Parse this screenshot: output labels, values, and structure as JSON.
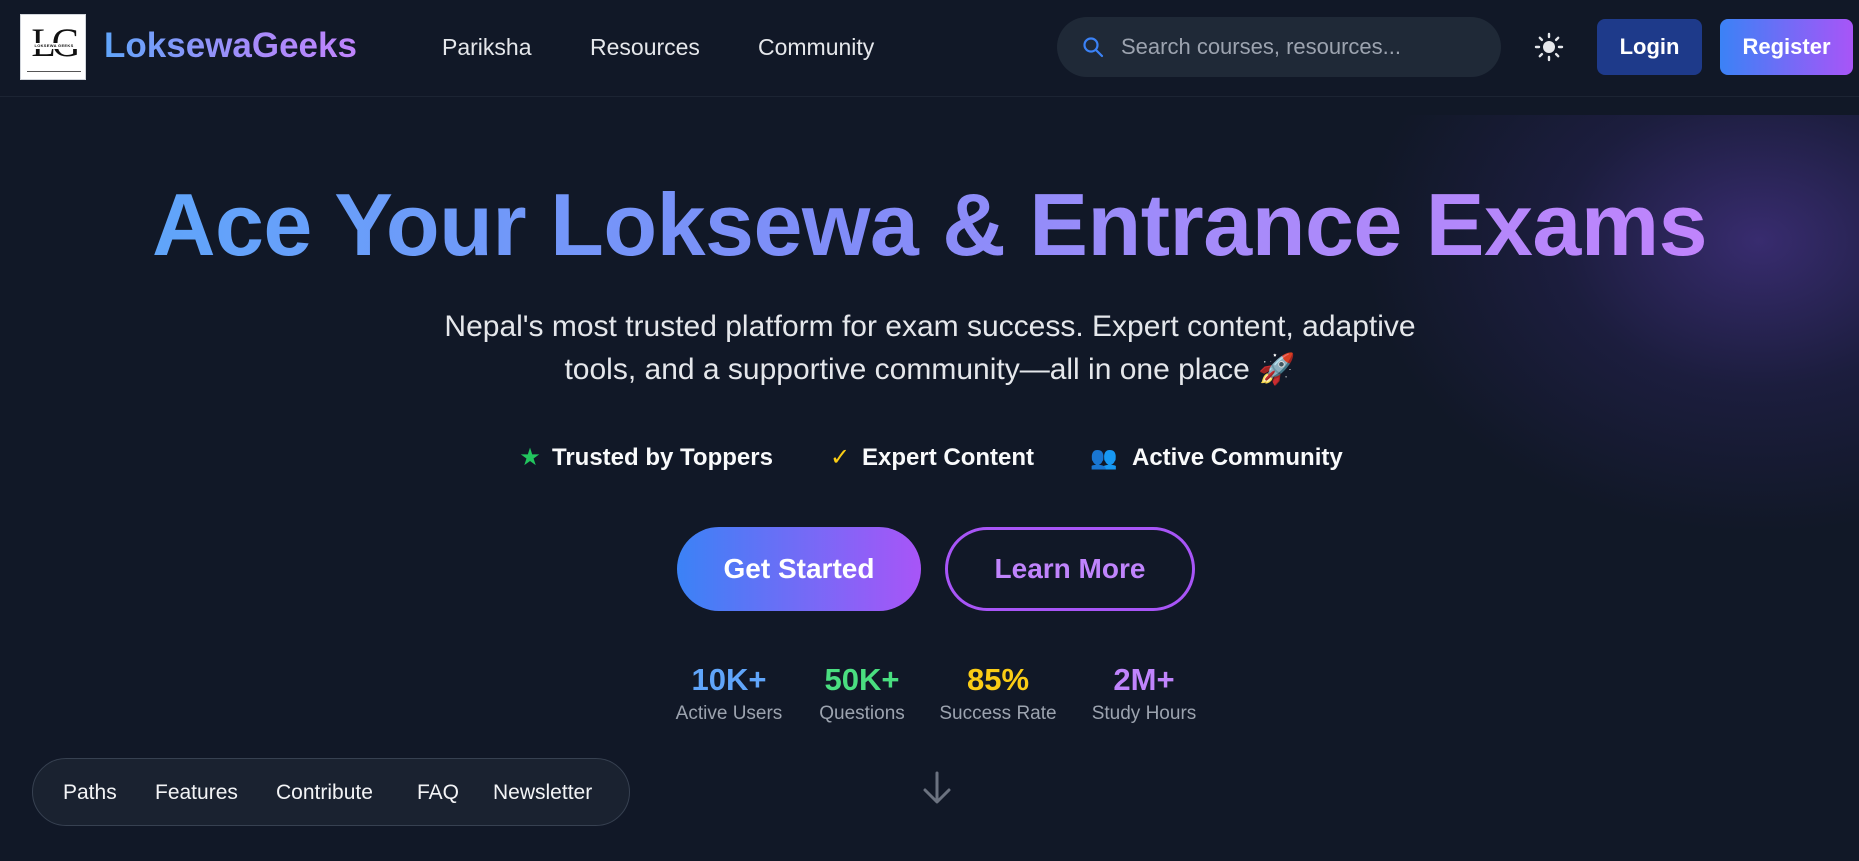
{
  "header": {
    "logo_text": "LG",
    "logo_tagline": "LOKSEWA GEEKS",
    "brand": "LoksewaGeeks",
    "nav": [
      "Pariksha",
      "Resources",
      "Community"
    ],
    "search_placeholder": "Search courses, resources...",
    "theme_icon": "sun-icon",
    "login_label": "Login",
    "register_label": "Register"
  },
  "hero": {
    "title": "Ace Your Loksewa & Entrance Exams",
    "subtitle": "Nepal's most trusted platform for exam success. Expert content, adaptive tools, and a supportive community—all in one place 🚀",
    "features": [
      {
        "icon": "star-icon",
        "glyph": "★",
        "label": "Trusted by Toppers",
        "color": "#22c55e"
      },
      {
        "icon": "check-icon",
        "glyph": "✓",
        "label": "Expert Content",
        "color": "#facc15"
      },
      {
        "icon": "people-icon",
        "glyph": "👥",
        "label": "Active Community",
        "color": "#7c6cd8"
      }
    ],
    "primary_cta": "Get Started",
    "secondary_cta": "Learn More",
    "stats": [
      {
        "value": "10K+",
        "label": "Active Users",
        "color": "#60a5fa"
      },
      {
        "value": "50K+",
        "label": "Questions",
        "color": "#4ade80"
      },
      {
        "value": "85%",
        "label": "Success Rate",
        "color": "#facc15"
      },
      {
        "value": "2M+",
        "label": "Study Hours",
        "color": "#c084fc"
      }
    ]
  },
  "section_nav": [
    "Paths",
    "Features",
    "Contribute",
    "FAQ",
    "Newsletter"
  ],
  "scroll_icon": "arrow-down-icon",
  "colors": {
    "background": "#111827",
    "accent_blue": "#3b82f6",
    "accent_purple": "#a855f7",
    "login_bg": "#1e3a8a"
  }
}
